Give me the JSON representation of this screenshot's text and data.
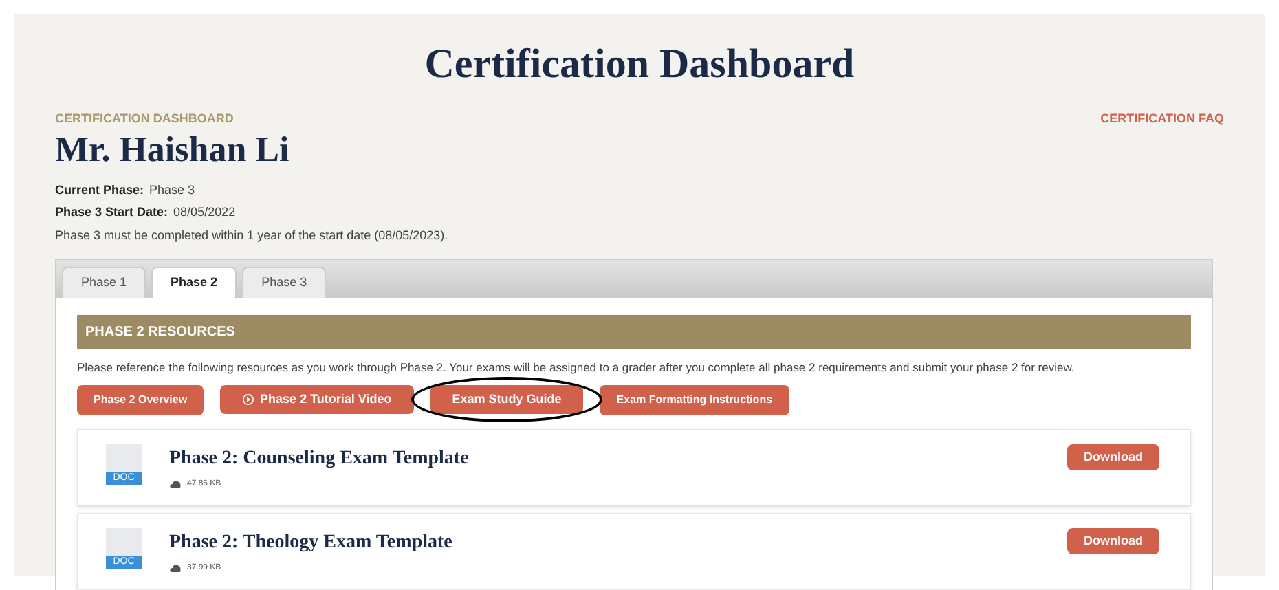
{
  "page_title": "Certification Dashboard",
  "eyebrow": "CERTIFICATION DASHBOARD",
  "faq_link": "CERTIFICATION FAQ",
  "name": "Mr. Haishan Li",
  "details": [
    {
      "label": "Current Phase:",
      "value": "Phase 3"
    },
    {
      "label": "Phase 3 Start Date:",
      "value": "08/05/2022"
    }
  ],
  "notice": "Phase 3 must be completed within 1 year of the start date (08/05/2023).",
  "tabs": [
    {
      "label": "Phase 1",
      "selected": false
    },
    {
      "label": "Phase 2",
      "selected": true
    },
    {
      "label": "Phase 3",
      "selected": false
    }
  ],
  "section_title": "PHASE 2 RESOURCES",
  "intro": "Please reference the following resources as you work through Phase 2. Your exams will be assigned to a grader after you complete all phase 2 requirements and submit your phase 2 for review.",
  "resource_buttons": [
    {
      "label": "Phase 2 Overview",
      "kind": "plain",
      "circled": false
    },
    {
      "label": "Phase 2 Tutorial Video",
      "kind": "video",
      "circled": false
    },
    {
      "label": "Exam Study Guide",
      "kind": "plain",
      "circled": true
    },
    {
      "label": "Exam Formatting Instructions",
      "kind": "plain",
      "circled": false
    }
  ],
  "files": [
    {
      "title": "Phase 2: Counseling Exam Template",
      "type": "DOC",
      "size": "47.86 KB",
      "action": "Download"
    },
    {
      "title": "Phase 2: Theology Exam Template",
      "type": "DOC",
      "size": "37.99 KB",
      "action": "Download"
    }
  ]
}
